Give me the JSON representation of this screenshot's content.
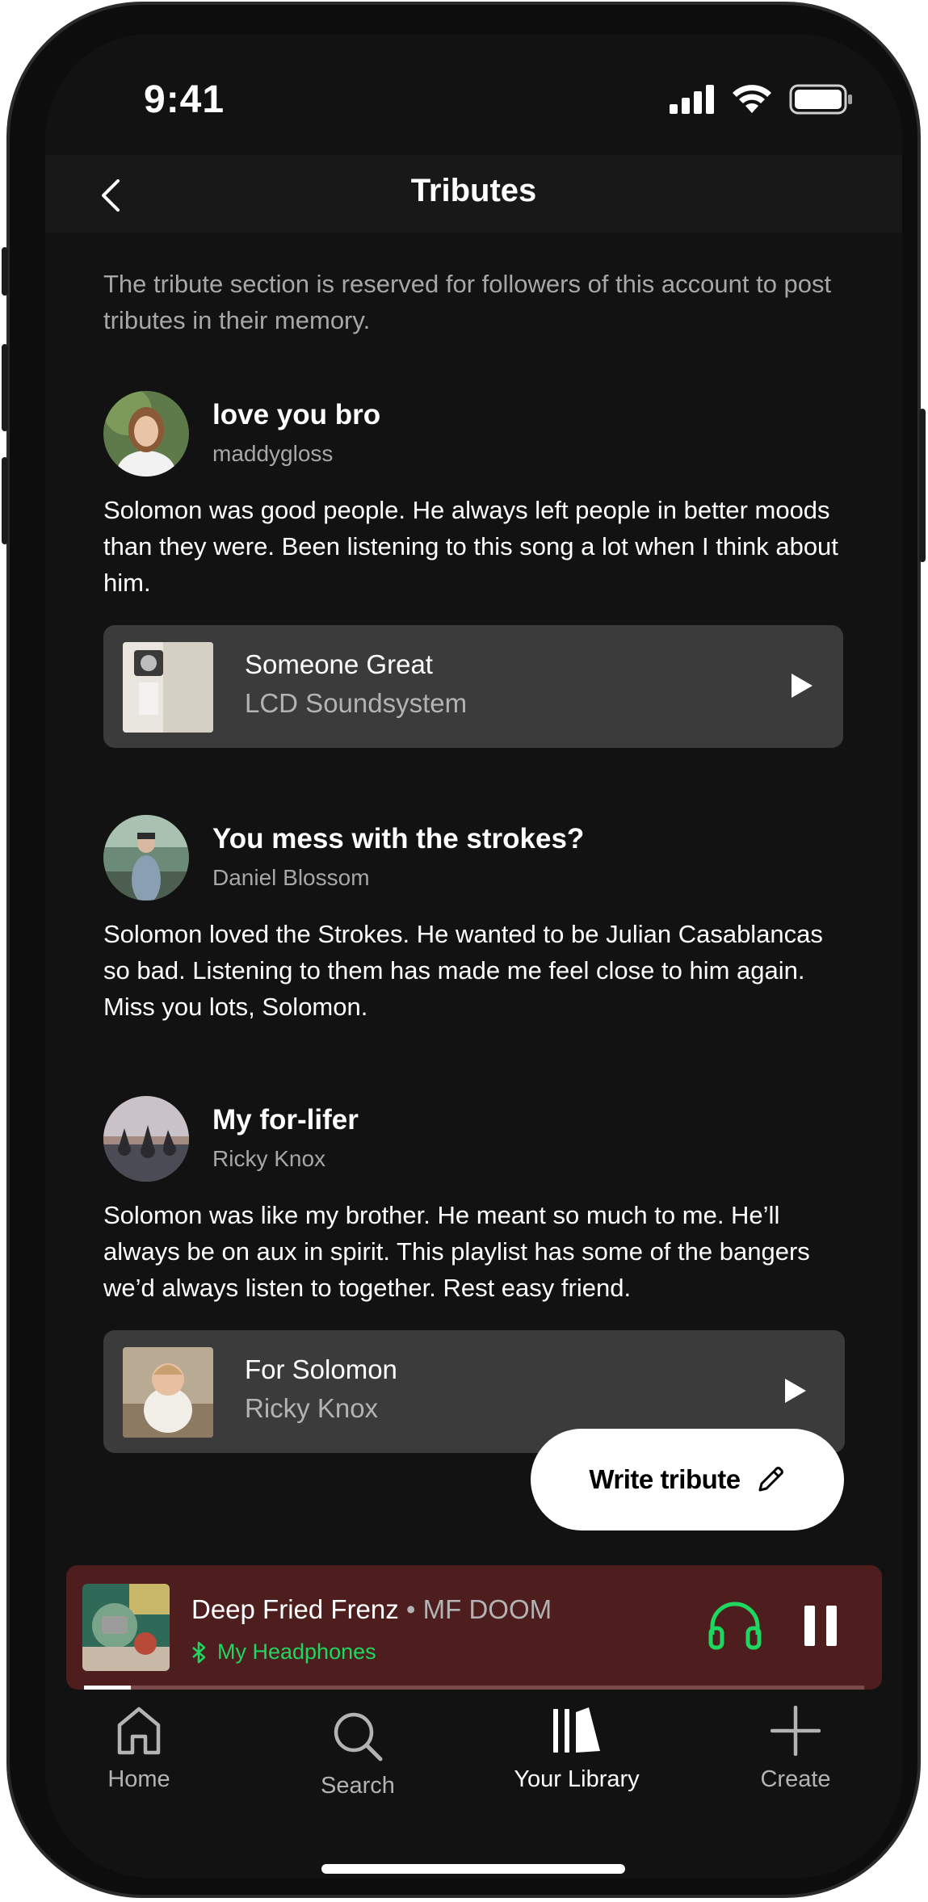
{
  "status_bar": {
    "time": "9:41"
  },
  "header": {
    "title": "Tributes"
  },
  "intro": "The tribute section is reserved for followers of this account to post tributes in their memory.",
  "tributes": [
    {
      "title": "love you bro",
      "author": "maddygloss",
      "body": "Solomon was good people. He always left people in better moods than they were. Been listening to this song a lot when I think about him.",
      "track": {
        "name": "Someone Great",
        "artist": "LCD Soundsystem"
      }
    },
    {
      "title": "You mess with the strokes?",
      "author": "Daniel Blossom",
      "body": "Solomon loved the Strokes. He wanted to be Julian Casablancas so bad. Listening to them has made me feel close to him again. Miss you lots, Solomon."
    },
    {
      "title": "My for-lifer",
      "author": "Ricky Knox",
      "body": "Solomon was like my brother. He meant so much to me. He’ll always be on aux in spirit. This playlist has some of the bangers we’d always listen to together. Rest easy friend.",
      "track": {
        "name": "For Solomon",
        "artist": "Ricky Knox"
      }
    }
  ],
  "write_button": {
    "label": "Write tribute"
  },
  "now_playing": {
    "title": "Deep Fried Frenz",
    "separator": " • ",
    "artist": "MF DOOM",
    "device": "My Headphones",
    "progress": 0.06,
    "accent": "#1ed760",
    "background": "#4e1e1e"
  },
  "nav": [
    {
      "label": "Home",
      "icon": "home-icon"
    },
    {
      "label": "Search",
      "icon": "search-icon"
    },
    {
      "label": "Your Library",
      "icon": "library-icon",
      "active": true
    },
    {
      "label": "Create",
      "icon": "plus-icon"
    }
  ]
}
